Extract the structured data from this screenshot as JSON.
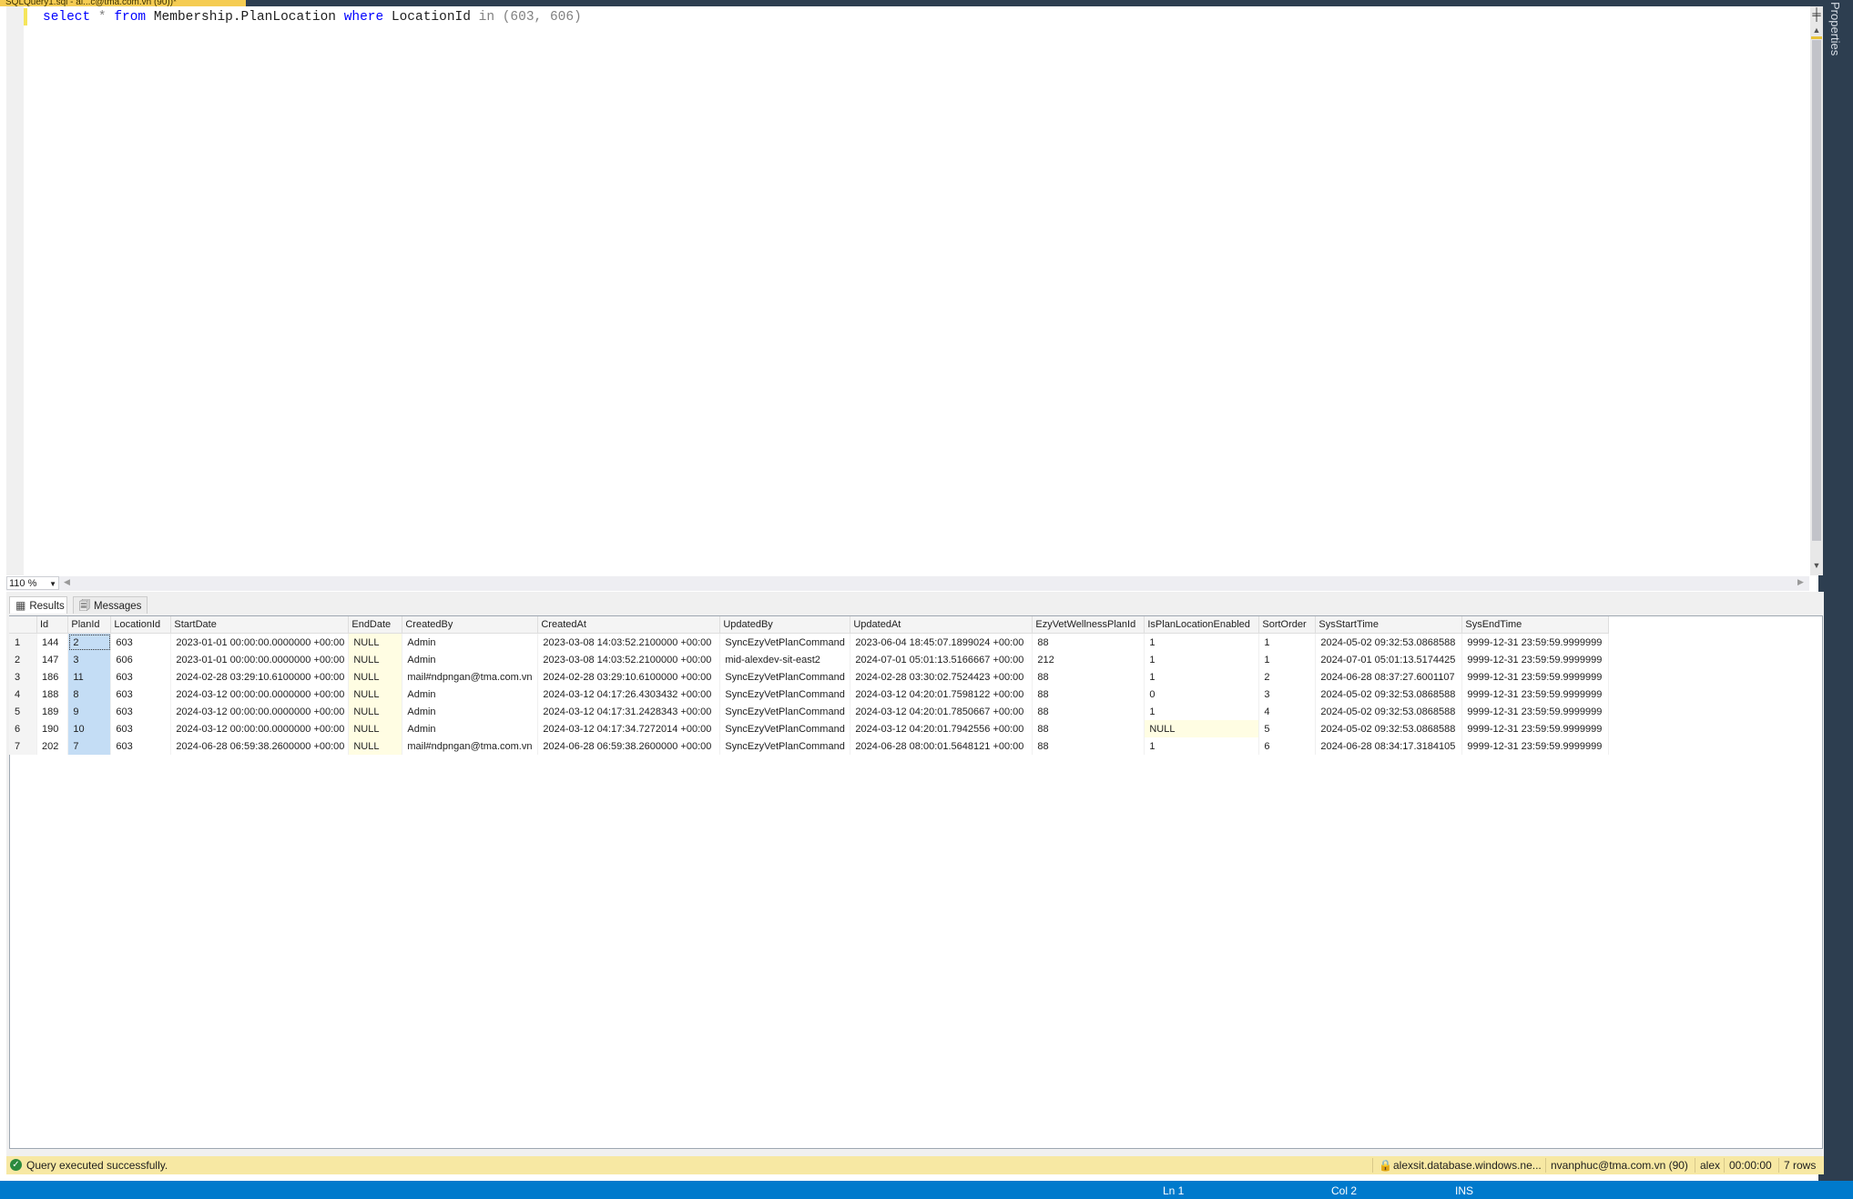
{
  "tab": {
    "title": "SQLQuery1.sql - al...c@tma.com.vn (90))*"
  },
  "rail": {
    "label": "Properties"
  },
  "editor": {
    "tokens": [
      "select",
      "*",
      "from",
      "Membership.PlanLocation",
      "where",
      "LocationId",
      "in",
      "(603, 606)"
    ]
  },
  "zoom": {
    "value": "110 %"
  },
  "results_tabs": {
    "results": "Results",
    "messages": "Messages"
  },
  "grid": {
    "columns": [
      "",
      "Id",
      "PlanId",
      "LocationId",
      "StartDate",
      "EndDate",
      "CreatedBy",
      "CreatedAt",
      "UpdatedBy",
      "UpdatedAt",
      "EzyVetWellnessPlanId",
      "IsPlanLocationEnabled",
      "SortOrder",
      "SysStartTime",
      "SysEndTime"
    ],
    "rows": [
      [
        "1",
        "144",
        "2",
        "603",
        "2023-01-01 00:00:00.0000000 +00:00",
        "NULL",
        "Admin",
        "2023-03-08 14:03:52.2100000 +00:00",
        "SyncEzyVetPlanCommand",
        "2023-06-04 18:45:07.1899024 +00:00",
        "88",
        "1",
        "1",
        "2024-05-02 09:32:53.0868588",
        "9999-12-31 23:59:59.9999999"
      ],
      [
        "2",
        "147",
        "3",
        "606",
        "2023-01-01 00:00:00.0000000 +00:00",
        "NULL",
        "Admin",
        "2023-03-08 14:03:52.2100000 +00:00",
        "mid-alexdev-sit-east2",
        "2024-07-01 05:01:13.5166667 +00:00",
        "212",
        "1",
        "1",
        "2024-07-01 05:01:13.5174425",
        "9999-12-31 23:59:59.9999999"
      ],
      [
        "3",
        "186",
        "11",
        "603",
        "2024-02-28 03:29:10.6100000 +00:00",
        "NULL",
        "mail#ndpngan@tma.com.vn",
        "2024-02-28 03:29:10.6100000 +00:00",
        "SyncEzyVetPlanCommand",
        "2024-02-28 03:30:02.7524423 +00:00",
        "88",
        "1",
        "2",
        "2024-06-28 08:37:27.6001107",
        "9999-12-31 23:59:59.9999999"
      ],
      [
        "4",
        "188",
        "8",
        "603",
        "2024-03-12 00:00:00.0000000 +00:00",
        "NULL",
        "Admin",
        "2024-03-12 04:17:26.4303432 +00:00",
        "SyncEzyVetPlanCommand",
        "2024-03-12 04:20:01.7598122 +00:00",
        "88",
        "0",
        "3",
        "2024-05-02 09:32:53.0868588",
        "9999-12-31 23:59:59.9999999"
      ],
      [
        "5",
        "189",
        "9",
        "603",
        "2024-03-12 00:00:00.0000000 +00:00",
        "NULL",
        "Admin",
        "2024-03-12 04:17:31.2428343 +00:00",
        "SyncEzyVetPlanCommand",
        "2024-03-12 04:20:01.7850667 +00:00",
        "88",
        "1",
        "4",
        "2024-05-02 09:32:53.0868588",
        "9999-12-31 23:59:59.9999999"
      ],
      [
        "6",
        "190",
        "10",
        "603",
        "2024-03-12 00:00:00.0000000 +00:00",
        "NULL",
        "Admin",
        "2024-03-12 04:17:34.7272014 +00:00",
        "SyncEzyVetPlanCommand",
        "2024-03-12 04:20:01.7942556 +00:00",
        "88",
        "NULL",
        "5",
        "2024-05-02 09:32:53.0868588",
        "9999-12-31 23:59:59.9999999"
      ],
      [
        "7",
        "202",
        "7",
        "603",
        "2024-06-28 06:59:38.2600000 +00:00",
        "NULL",
        "mail#ndpngan@tma.com.vn",
        "2024-06-28 06:59:38.2600000 +00:00",
        "SyncEzyVetPlanCommand",
        "2024-06-28 08:00:01.5648121 +00:00",
        "88",
        "1",
        "6",
        "2024-06-28 08:34:17.3184105",
        "9999-12-31 23:59:59.9999999"
      ]
    ]
  },
  "status": {
    "message": "Query executed successfully.",
    "server": "alexsit.database.windows.ne...",
    "user": "nvanphuc@tma.com.vn (90)",
    "database": "alex",
    "elapsed": "00:00:00",
    "rows": "7 rows"
  },
  "bottom": {
    "line": "Ln 1",
    "col": "Col 2",
    "mode": "INS"
  },
  "colors": {
    "accent": "#007acc",
    "keyword": "#0000ff",
    "status_bg": "#f7e8a3",
    "tab_active": "#f5cc52"
  }
}
